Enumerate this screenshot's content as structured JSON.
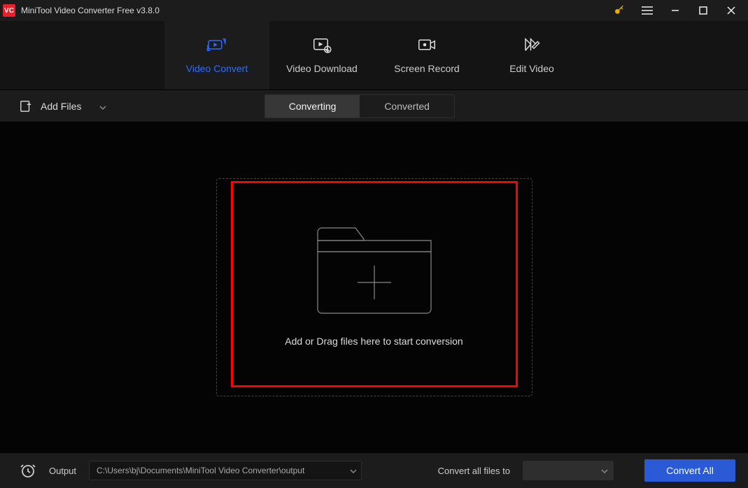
{
  "title": "MiniTool Video Converter Free v3.8.0",
  "nav": {
    "items": [
      {
        "label": "Video Convert"
      },
      {
        "label": "Video Download"
      },
      {
        "label": "Screen Record"
      },
      {
        "label": "Edit Video"
      }
    ]
  },
  "toolbar": {
    "add_files": "Add Files",
    "tabs": [
      {
        "label": "Converting"
      },
      {
        "label": "Converted"
      }
    ]
  },
  "dropzone": {
    "text": "Add or Drag files here to start conversion"
  },
  "footer": {
    "output_label": "Output",
    "output_path": "C:\\Users\\bj\\Documents\\MiniTool Video Converter\\output",
    "convert_all_label": "Convert all files to",
    "convert_button": "Convert All"
  }
}
